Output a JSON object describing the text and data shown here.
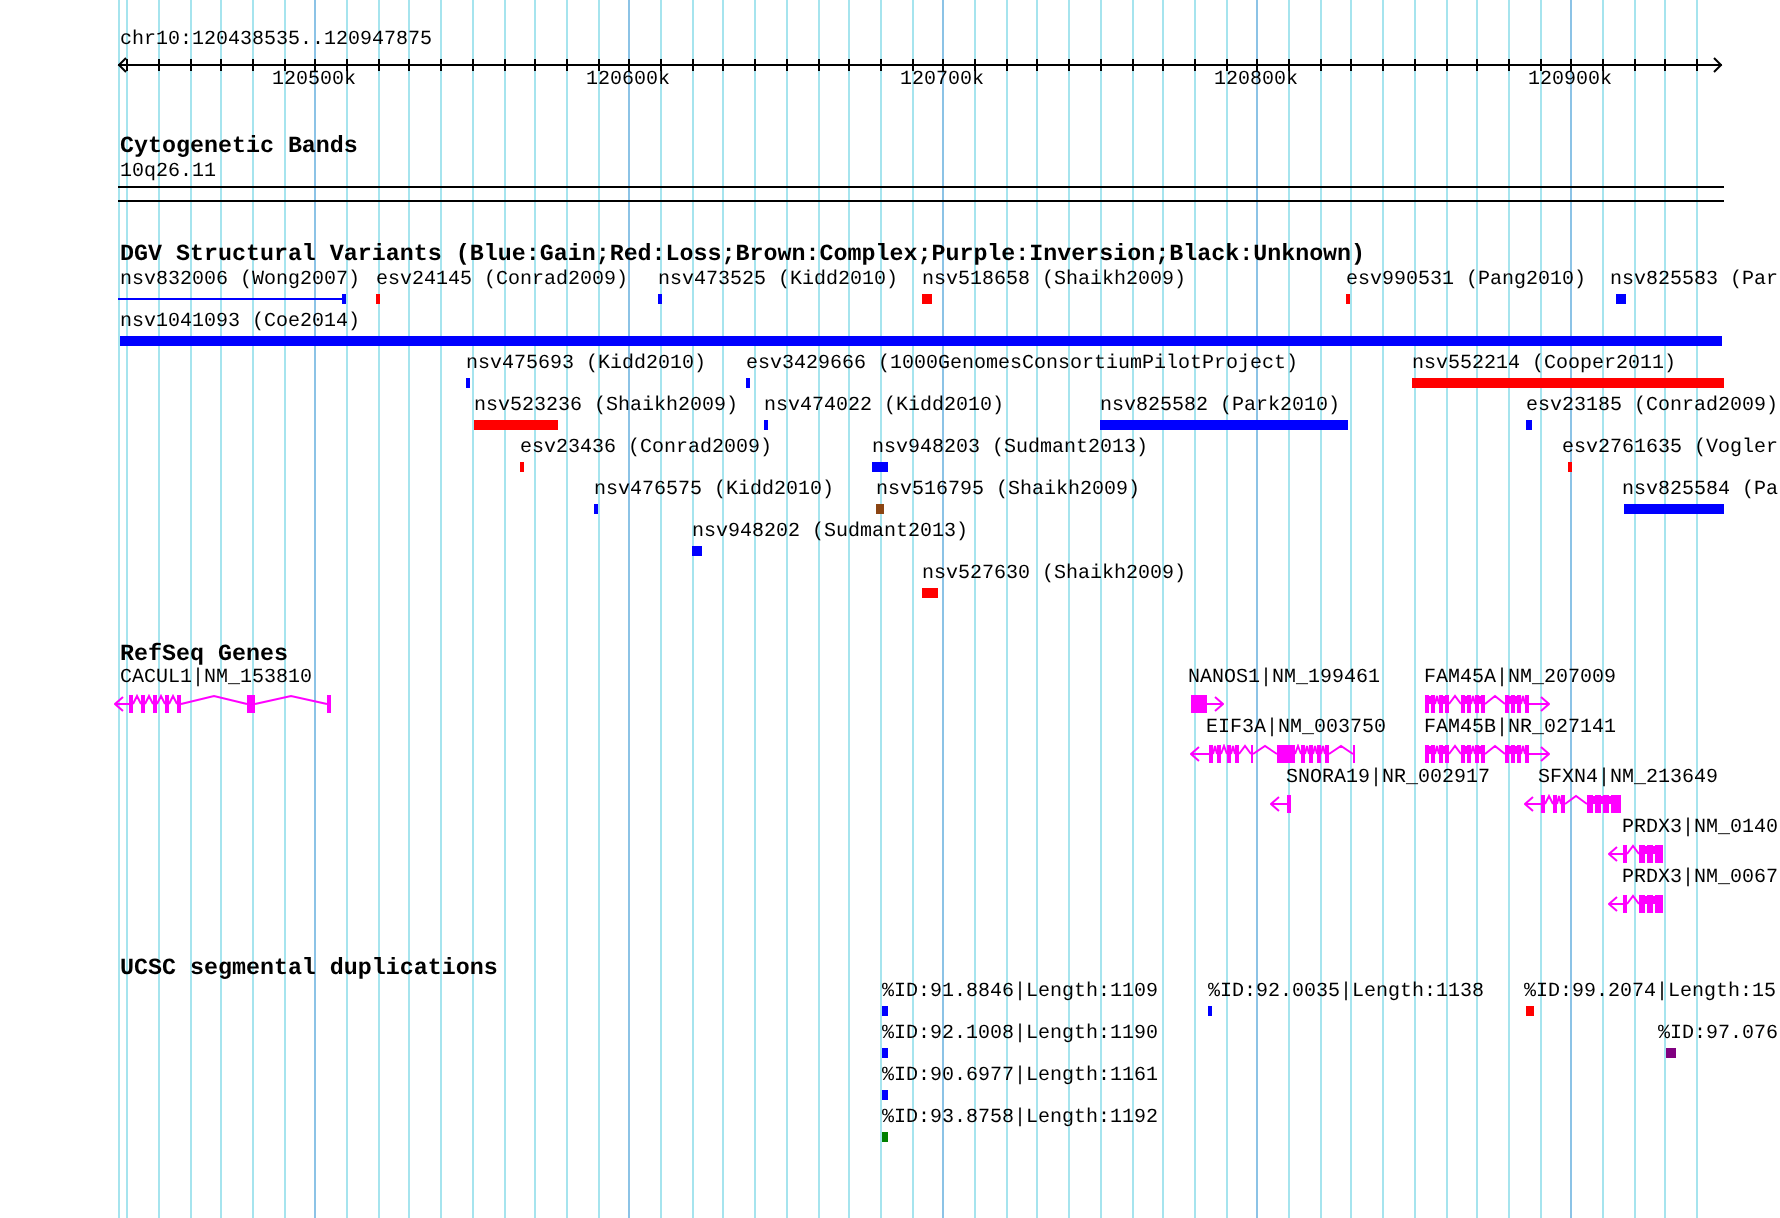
{
  "ruler": {
    "region": "chr10:120438535..120947875",
    "ticks": [
      "120500k",
      "120600k",
      "120700k",
      "120800k",
      "120900k"
    ]
  },
  "tracks": [
    {
      "kind": "cytoband",
      "title": "Cytogenetic Bands",
      "band": "10q26.11"
    },
    {
      "kind": "variants",
      "title": "DGV Structural Variants (Blue:Gain;Red:Loss;Brown:Complex;Purple:Inversion;Black:Unknown)",
      "rows": [
        {
          "features": [
            {
              "label": "nsv832006 (Wong2007)",
              "color": "#0000ff",
              "kind": "clipped"
            },
            {
              "label": "esv24145 (Conrad2009)",
              "color": "#ff0000",
              "kind": "block"
            },
            {
              "label": "nsv473525 (Kidd2010)",
              "color": "#0000ff",
              "kind": "block"
            },
            {
              "label": "nsv518658 (Shaikh2009)",
              "color": "#ff0000",
              "kind": "block"
            },
            {
              "label": "esv990531 (Pang2010)",
              "color": "#ff0000",
              "kind": "block"
            },
            {
              "label": "nsv825583 (Par",
              "color": "#0000ff",
              "kind": "block"
            }
          ]
        },
        {
          "features": [
            {
              "label": "nsv1041093 (Coe2014)",
              "color": "#0000ff",
              "kind": "block"
            }
          ]
        },
        {
          "features": [
            {
              "label": "nsv475693 (Kidd2010)",
              "color": "#0000ff",
              "kind": "block"
            },
            {
              "label": "esv3429666 (1000GenomesConsortiumPilotProject)",
              "color": "#0000ff",
              "kind": "block"
            },
            {
              "label": "nsv552214 (Cooper2011)",
              "color": "#ff0000",
              "kind": "block"
            }
          ]
        },
        {
          "features": [
            {
              "label": "nsv523236 (Shaikh2009)",
              "color": "#ff0000",
              "kind": "block"
            },
            {
              "label": "nsv474022 (Kidd2010)",
              "color": "#0000ff",
              "kind": "block"
            },
            {
              "label": "nsv825582 (Park2010)",
              "color": "#0000ff",
              "kind": "block"
            },
            {
              "label": "esv23185 (Conrad2009)",
              "color": "#0000ff",
              "kind": "block"
            }
          ]
        },
        {
          "features": [
            {
              "label": "esv23436 (Conrad2009)",
              "color": "#ff0000",
              "kind": "block"
            },
            {
              "label": "nsv948203 (Sudmant2013)",
              "color": "#0000ff",
              "kind": "block"
            },
            {
              "label": "esv2761635 (Vogler",
              "color": "#ff0000",
              "kind": "block"
            }
          ]
        },
        {
          "features": [
            {
              "label": "nsv476575 (Kidd2010)",
              "color": "#0000ff",
              "kind": "block"
            },
            {
              "label": "nsv516795 (Shaikh2009)",
              "color": "#8b4513",
              "kind": "block"
            },
            {
              "label": "nsv825584 (Pa",
              "color": "#0000ff",
              "kind": "block"
            }
          ]
        },
        {
          "features": [
            {
              "label": "nsv948202 (Sudmant2013)",
              "color": "#0000ff",
              "kind": "block"
            }
          ]
        },
        {
          "features": [
            {
              "label": "nsv527630 (Shaikh2009)",
              "color": "#ff0000",
              "kind": "block"
            }
          ]
        }
      ]
    },
    {
      "kind": "genes",
      "title": "RefSeq Genes",
      "rows": [
        {
          "features": [
            {
              "label": "CACUL1|NM_153810",
              "reverse_strand": true
            },
            {
              "label": "NANOS1|NM_199461",
              "reverse_strand": false
            },
            {
              "label": "FAM45A|NM_207009",
              "reverse_strand": false
            }
          ]
        },
        {
          "features": [
            {
              "label": "EIF3A|NM_003750",
              "reverse_strand": true
            },
            {
              "label": "FAM45B|NR_027141",
              "reverse_strand": false
            }
          ]
        },
        {
          "features": [
            {
              "label": "SNORA19|NR_002917",
              "reverse_strand": true
            },
            {
              "label": "SFXN4|NM_213649",
              "reverse_strand": true
            }
          ]
        },
        {
          "features": [
            {
              "label": "PRDX3|NM_0140",
              "reverse_strand": true
            }
          ]
        },
        {
          "features": [
            {
              "label": "PRDX3|NM_0067",
              "reverse_strand": true
            }
          ]
        }
      ]
    },
    {
      "kind": "segdups",
      "title": "UCSC segmental duplications",
      "rows": [
        {
          "features": [
            {
              "label": "%ID:91.8846|Length:1109",
              "color": "#0000ff"
            },
            {
              "label": "%ID:92.0035|Length:1138",
              "color": "#0000ff"
            },
            {
              "label": "%ID:99.2074|Length:15",
              "color": "#ff0000"
            }
          ]
        },
        {
          "features": [
            {
              "label": "%ID:92.1008|Length:1190",
              "color": "#0000ff"
            },
            {
              "label": "%ID:97.076",
              "color": "#800080"
            }
          ]
        },
        {
          "features": [
            {
              "label": "%ID:90.6977|Length:1161",
              "color": "#0000ff"
            }
          ]
        },
        {
          "features": [
            {
              "label": "%ID:93.8758|Length:1192",
              "color": "#008000"
            }
          ]
        }
      ]
    }
  ]
}
